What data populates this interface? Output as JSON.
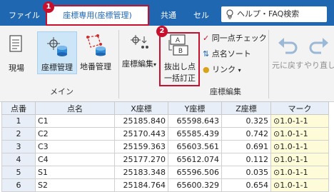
{
  "tabs": {
    "file": "ファイル",
    "active": "座標専用(座標管理)",
    "common": "共通",
    "cell": "セル"
  },
  "search": {
    "placeholder": "ヘルプ・FAQ検索"
  },
  "badges": {
    "one": "1",
    "two": "2"
  },
  "ribbon": {
    "genba": "現場",
    "zahyo_kanri": "座標管理",
    "chiban_kanri": "地番管理",
    "main_group": "メイン",
    "zahyo_henshu": "座標編集",
    "batsu_line1": "抜出し点",
    "batsu_line2": "一括訂正",
    "doitsu": "同一点チェック",
    "tenmei": "点名ソート",
    "link": "リンク",
    "edit_group": "座標編集",
    "undo": "元に戻す",
    "redo": "やり直し",
    "icon_a": "A",
    "icon_b": "B"
  },
  "table": {
    "headers": [
      "点番",
      "点名",
      "X座標",
      "Y座標",
      "Z座標",
      "マーク"
    ],
    "rows": [
      {
        "num": "1",
        "name": "C1",
        "x": "25185.840",
        "y": "65598.643",
        "z": "0.325",
        "mark": "1.0-1-1"
      },
      {
        "num": "2",
        "name": "C2",
        "x": "25170.443",
        "y": "65585.439",
        "z": "0.742",
        "mark": "1.0-1-1"
      },
      {
        "num": "3",
        "name": "C3",
        "x": "25159.363",
        "y": "65603.561",
        "z": "0.691",
        "mark": "1.0-1-1"
      },
      {
        "num": "4",
        "name": "C4",
        "x": "25177.270",
        "y": "65612.074",
        "z": "0.112",
        "mark": "1.0-1-1"
      },
      {
        "num": "5",
        "name": "S1",
        "x": "25183.348",
        "y": "65596.506",
        "z": "0.035",
        "mark": "1.0-1-1"
      },
      {
        "num": "6",
        "name": "S2",
        "x": "25184.764",
        "y": "65600.329",
        "z": "0.654",
        "mark": "1.0-1-1"
      }
    ]
  }
}
